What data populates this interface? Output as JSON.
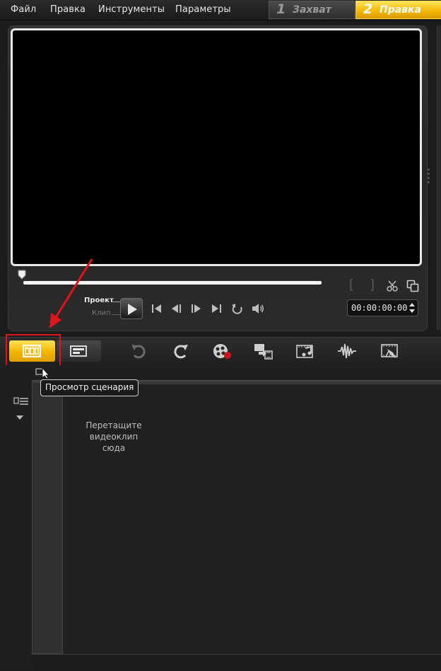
{
  "menubar": {
    "items": [
      "Файл",
      "Правка",
      "Инструменты",
      "Параметры"
    ]
  },
  "steps": [
    {
      "number": "1",
      "label": "Захват",
      "state": "inactive"
    },
    {
      "number": "2",
      "label": "Правка",
      "state": "active"
    }
  ],
  "player": {
    "mode_project": "Проект",
    "mode_clip": "Клип",
    "timecode": "00:00:00:00",
    "controls": [
      "play-icon",
      "skip-to-start-icon",
      "step-back-icon",
      "step-forward-icon",
      "skip-to-end-icon",
      "repeat-icon",
      "volume-icon"
    ],
    "trim": {
      "mark_in": "[",
      "mark_out": "]"
    }
  },
  "toolbar": {
    "tooltip": "Просмотр сценария",
    "buttons": [
      "storyboard-view-icon",
      "timeline-view-icon",
      "undo-icon",
      "redo-icon",
      "record-capture-icon",
      "export-icon",
      "auto-music-icon",
      "audio-waveform-icon",
      "movie-wizard-icon"
    ]
  },
  "storyboard": {
    "drop_hint_line1": "Перетащите",
    "drop_hint_line2": "видеоклип",
    "drop_hint_line3": "сюда"
  },
  "colors": {
    "accent_yellow": "#f3b300",
    "highlight_red": "#e0141c",
    "background": "#1c1c1c"
  }
}
